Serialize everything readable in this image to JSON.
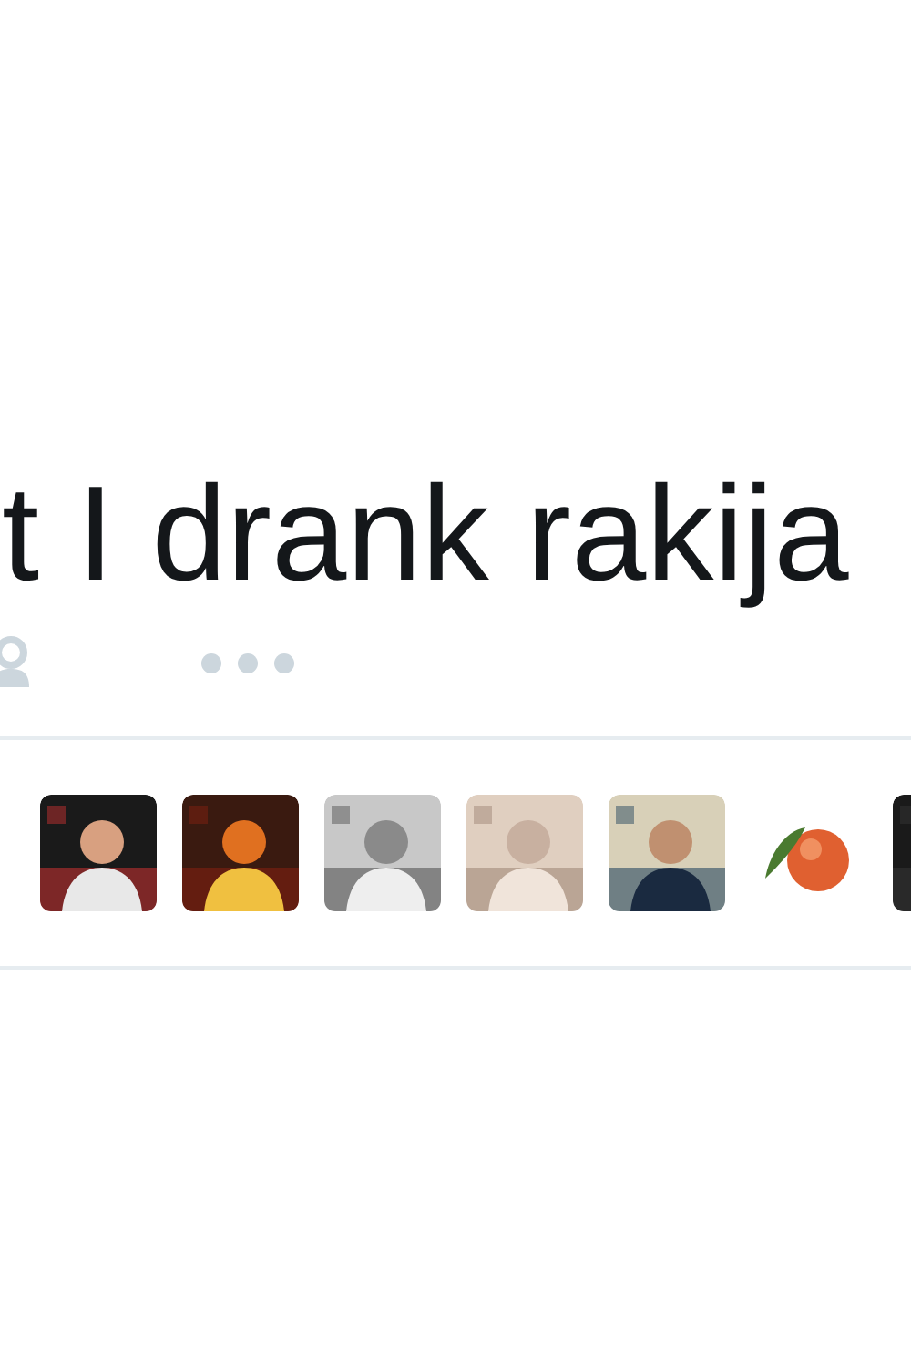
{
  "tweet": {
    "text": "t I drank rakija"
  }
}
